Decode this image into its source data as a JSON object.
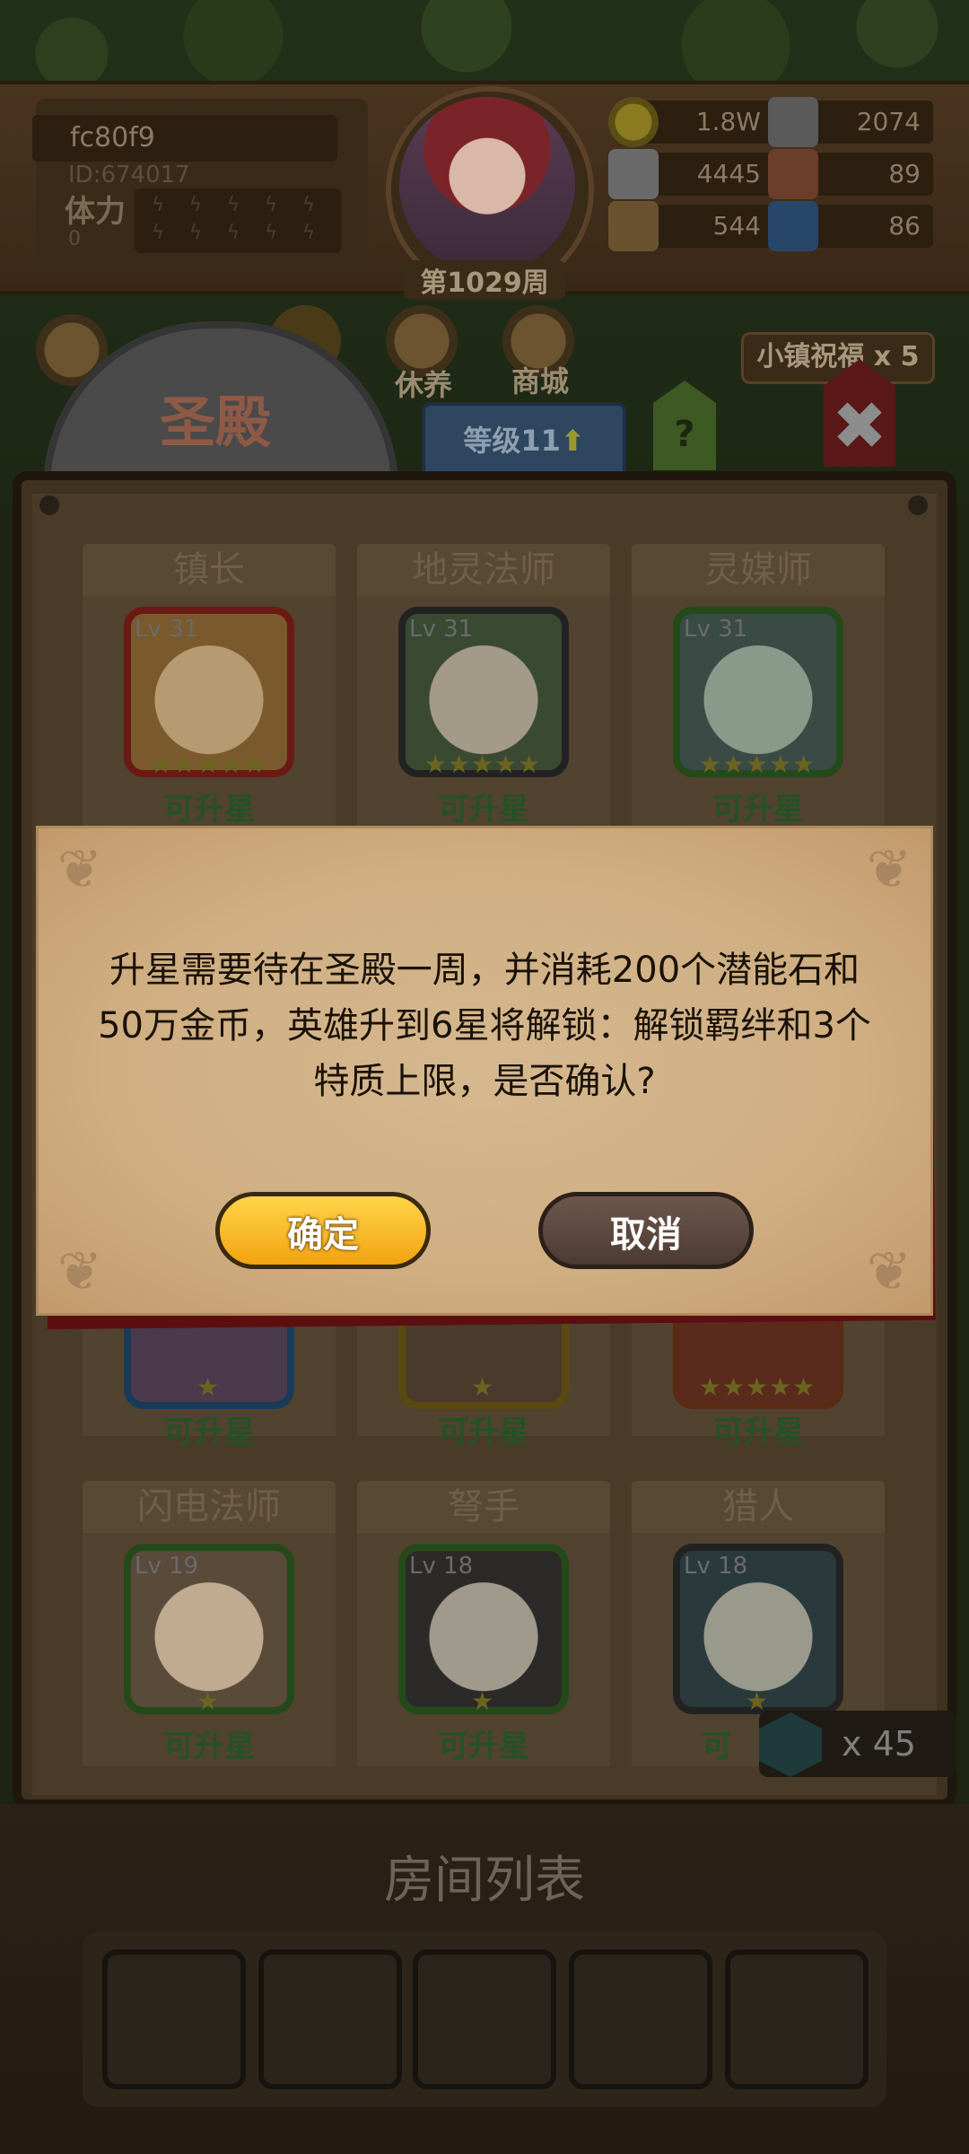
{
  "header": {
    "player_name": "fc80f9",
    "player_id": "ID:674017",
    "stamina_label": "体力",
    "stamina_value": "0",
    "week": "第1029周"
  },
  "resources": [
    {
      "icon": "gold-coin-icon",
      "value": "1.8W"
    },
    {
      "icon": "iron-ore-icon",
      "value": "2074"
    },
    {
      "icon": "stone-ore-icon",
      "value": "4445"
    },
    {
      "icon": "leather-icon",
      "value": "89"
    },
    {
      "icon": "wood-log-icon",
      "value": "544"
    },
    {
      "icon": "crystal-icon",
      "value": "86"
    }
  ],
  "nav": {
    "rest": "休养",
    "shop": "商城",
    "blessing": "小镇祝福 x 5"
  },
  "building": {
    "title": "圣殿",
    "level": "等级11",
    "level_arrow": "⬆",
    "help": "?",
    "close": "✖"
  },
  "heroes": [
    {
      "name": "镇长",
      "level": "Lv 31",
      "stars": "★★★★★",
      "status": "可升星"
    },
    {
      "name": "地灵法师",
      "level": "Lv 31",
      "stars": "★★★★★",
      "status": "可升星"
    },
    {
      "name": "灵媒师",
      "level": "Lv 31",
      "stars": "★★★★★",
      "status": "可升星"
    },
    {
      "name": "",
      "level": "",
      "stars": "★",
      "status": "可升星"
    },
    {
      "name": "",
      "level": "",
      "stars": "★",
      "status": "可升星"
    },
    {
      "name": "",
      "level": "",
      "stars": "★★★★★",
      "status": "可升星"
    },
    {
      "name": "闪电法师",
      "level": "Lv 19",
      "stars": "★",
      "status": "可升星"
    },
    {
      "name": "弩手",
      "level": "Lv 18",
      "stars": "★",
      "status": "可升星"
    },
    {
      "name": "猎人",
      "level": "Lv 18",
      "stars": "★",
      "status": "可"
    }
  ],
  "potential_stone": {
    "value": "x 45"
  },
  "rooms": {
    "title": "房间列表",
    "slots": 5
  },
  "dialog": {
    "line1": "升星需要待在圣殿一周，并消耗200个潜能石和",
    "line2": "50万金币，英雄升到6星将解锁：解锁羁绊和3个",
    "line3": "特质上限，是否确认?",
    "confirm": "确定",
    "cancel": "取消"
  },
  "colors": {
    "confirm_button": "#f2a310",
    "cancel_button": "#4c3b33",
    "dialog_paper": "#d6b88f",
    "upgrade_label": "#255225"
  }
}
